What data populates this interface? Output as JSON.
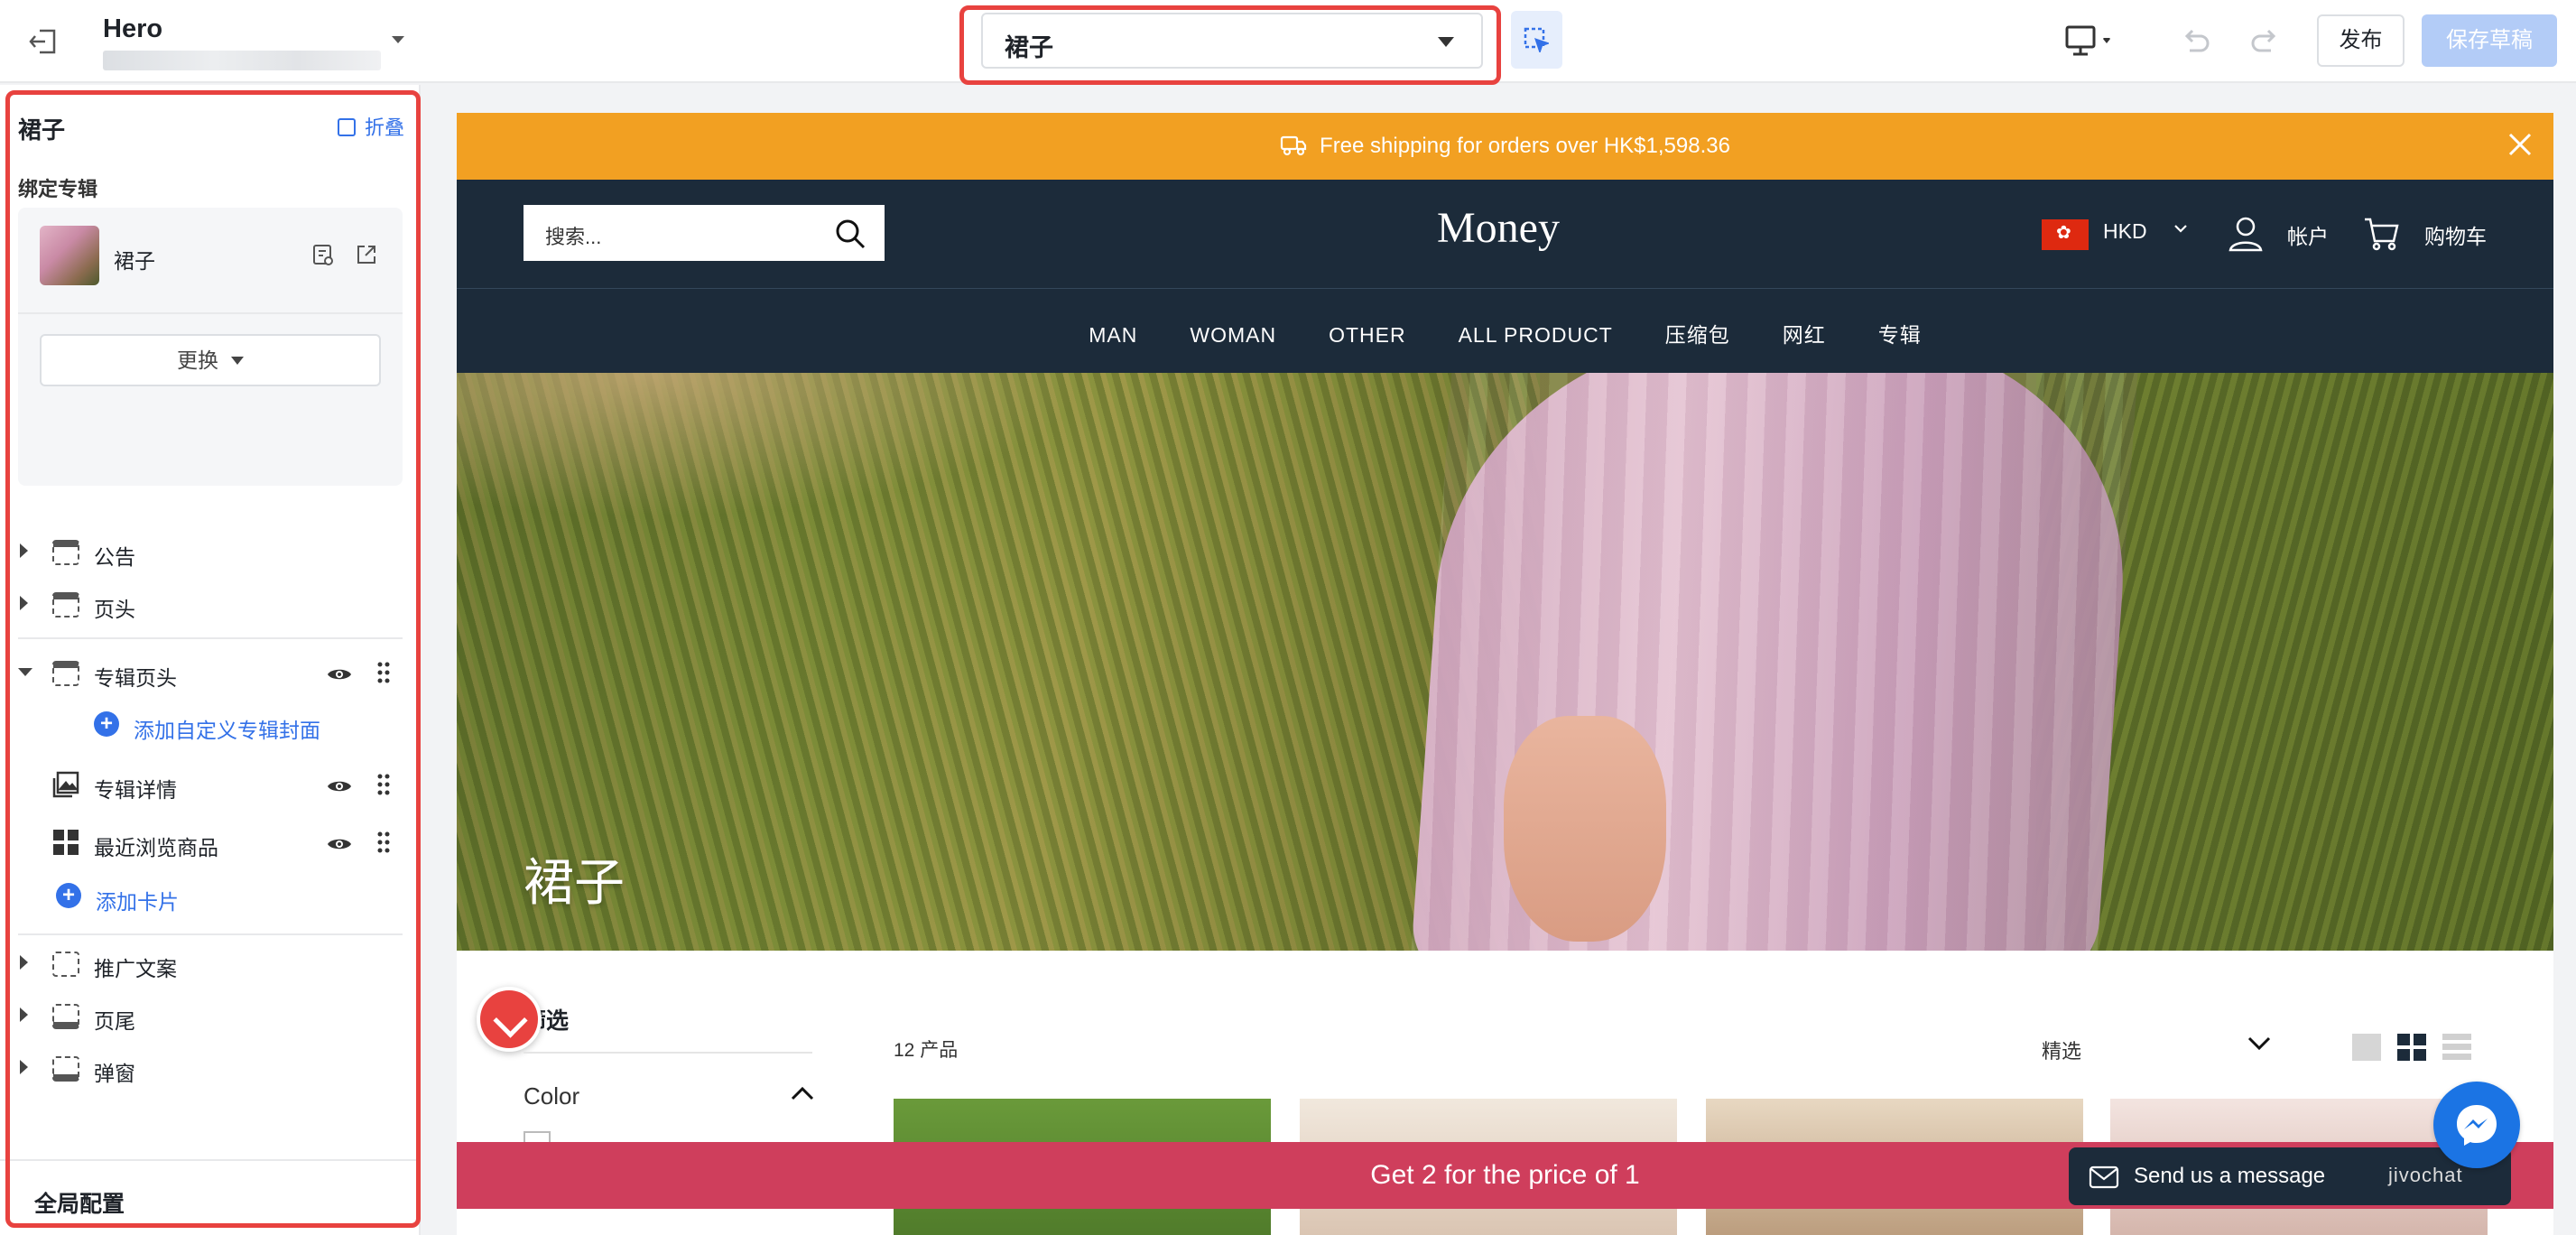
{
  "topbar": {
    "title": "Hero",
    "page_select": "裙子",
    "publish_label": "发布",
    "save_draft_label": "保存草稿"
  },
  "sidebar": {
    "heading": "裙子",
    "collapse_label": "折叠",
    "bind_label": "绑定专辑",
    "bound_collection": "裙子",
    "replace_label": "更换",
    "sections": [
      {
        "label": "公告"
      },
      {
        "label": "页头"
      },
      {
        "label": "专辑页头"
      },
      {
        "label": "专辑详情"
      },
      {
        "label": "最近浏览商品"
      },
      {
        "label": "推广文案"
      },
      {
        "label": "页尾"
      },
      {
        "label": "弹窗"
      }
    ],
    "add_cover_label": "添加自定义专辑封面",
    "add_card_label": "添加卡片",
    "global_config_label": "全局配置"
  },
  "store": {
    "announcement": "Free shipping for orders over HK$1,598.36",
    "search_placeholder": "搜索...",
    "logo": "Money",
    "currency": "HKD",
    "account_label": "帐户",
    "cart_label": "购物车",
    "nav": [
      "MAN",
      "WOMAN",
      "OTHER",
      "ALL PRODUCT",
      "压缩包",
      "网红",
      "专辑"
    ],
    "hero_title": "裙子",
    "filter_title": "筛选",
    "filter_color_label": "Color",
    "product_count": "12 产品",
    "sort_label": "精选",
    "promo_bar": "Get 2 for the price of 1",
    "message_label": "Send us a message",
    "chat_brand": "jivochat"
  },
  "colors": {
    "accent": "#3371e8",
    "highlight": "#e8423f",
    "announcement_bg": "#f2a022",
    "store_header_bg": "#1c2b3a",
    "promo_bg": "#cf3e5c"
  }
}
